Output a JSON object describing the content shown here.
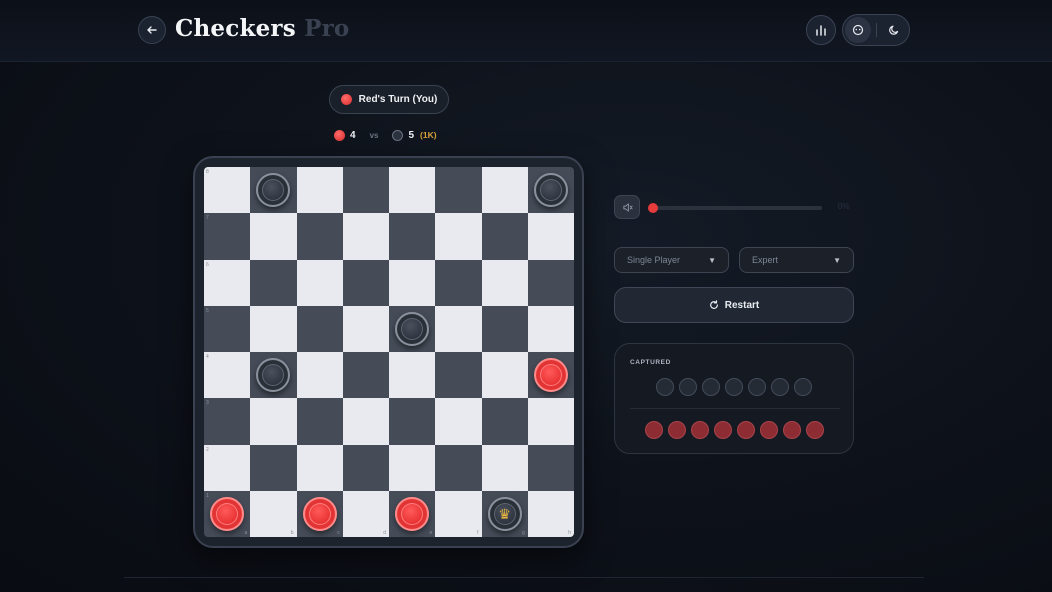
{
  "header": {
    "title": "Checkers",
    "title_faded": " Pro",
    "back_icon": "arrow-left-icon",
    "stats_icon": "bar-chart-icon",
    "mode_icon": "gamepad-icon",
    "theme_icon": "moon-icon"
  },
  "status": {
    "turn_text": "Red's Turn (You)",
    "turn_color": "#e63b3b",
    "red_count": "4",
    "vs_text": "vs",
    "black_count": "5",
    "black_tag": "(1K)"
  },
  "board": {
    "rank_labels": [
      "8",
      "7",
      "6",
      "5",
      "4",
      "3",
      "2",
      "1"
    ],
    "file_labels": [
      "a",
      "b",
      "c",
      "d",
      "e",
      "f",
      "g",
      "h"
    ],
    "pieces": [
      {
        "row": 0,
        "col": 1,
        "color": "black",
        "king": false
      },
      {
        "row": 0,
        "col": 7,
        "color": "black",
        "king": false
      },
      {
        "row": 3,
        "col": 4,
        "color": "black",
        "king": false
      },
      {
        "row": 4,
        "col": 1,
        "color": "black",
        "king": false
      },
      {
        "row": 4,
        "col": 7,
        "color": "red",
        "king": false
      },
      {
        "row": 7,
        "col": 0,
        "color": "red",
        "king": false
      },
      {
        "row": 7,
        "col": 2,
        "color": "red",
        "king": false
      },
      {
        "row": 7,
        "col": 4,
        "color": "red",
        "king": false
      },
      {
        "row": 7,
        "col": 6,
        "color": "black",
        "king": true
      }
    ],
    "light_color": "#e8eaef",
    "dark_color": "#454c58"
  },
  "controls": {
    "volume_icon": "speaker-icon",
    "volume_level": 0,
    "volume_value": "0%",
    "mode_select": "Single Player",
    "difficulty_select": "Expert",
    "restart_label": "Restart",
    "restart_icon": "refresh-icon"
  },
  "captured": {
    "title": "CAPTURED",
    "black_count": 7,
    "red_count": 8
  }
}
